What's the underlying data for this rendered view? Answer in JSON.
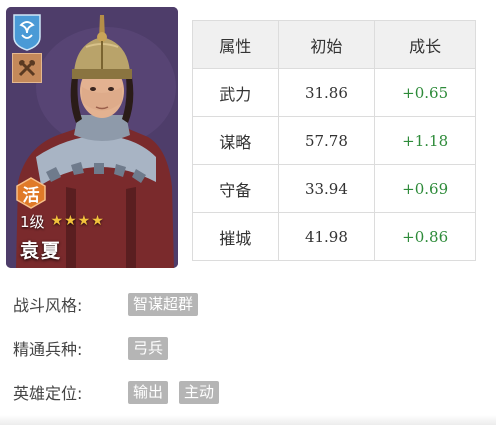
{
  "hero": {
    "name": "袁夏",
    "level": "1级",
    "stars": "★★★★",
    "tag": "活",
    "faction_icon": "shield-crest-icon",
    "type_icon": "crossed-axes-icon"
  },
  "stats_table": {
    "headers": [
      "属性",
      "初始",
      "成长"
    ],
    "rows": [
      {
        "attribute": "武力",
        "initial": "31.86",
        "growth": "+0.65"
      },
      {
        "attribute": "谋略",
        "initial": "57.78",
        "growth": "+1.18"
      },
      {
        "attribute": "守备",
        "initial": "33.94",
        "growth": "+0.69"
      },
      {
        "attribute": "摧城",
        "initial": "41.98",
        "growth": "+0.86"
      }
    ]
  },
  "info": {
    "style": {
      "label": "战斗风格:",
      "tags": [
        "智谋超群"
      ]
    },
    "troop": {
      "label": "精通兵种:",
      "tags": [
        "弓兵"
      ]
    },
    "role": {
      "label": "英雄定位:",
      "tags": [
        "输出",
        "主动"
      ]
    }
  },
  "colors": {
    "growth": "#2e8b3a",
    "card_bg": "#4c3b66",
    "tag_orange": "#e07a28",
    "pill_gray": "#b5b5b5",
    "faction_blue": "#4a9ad6"
  }
}
